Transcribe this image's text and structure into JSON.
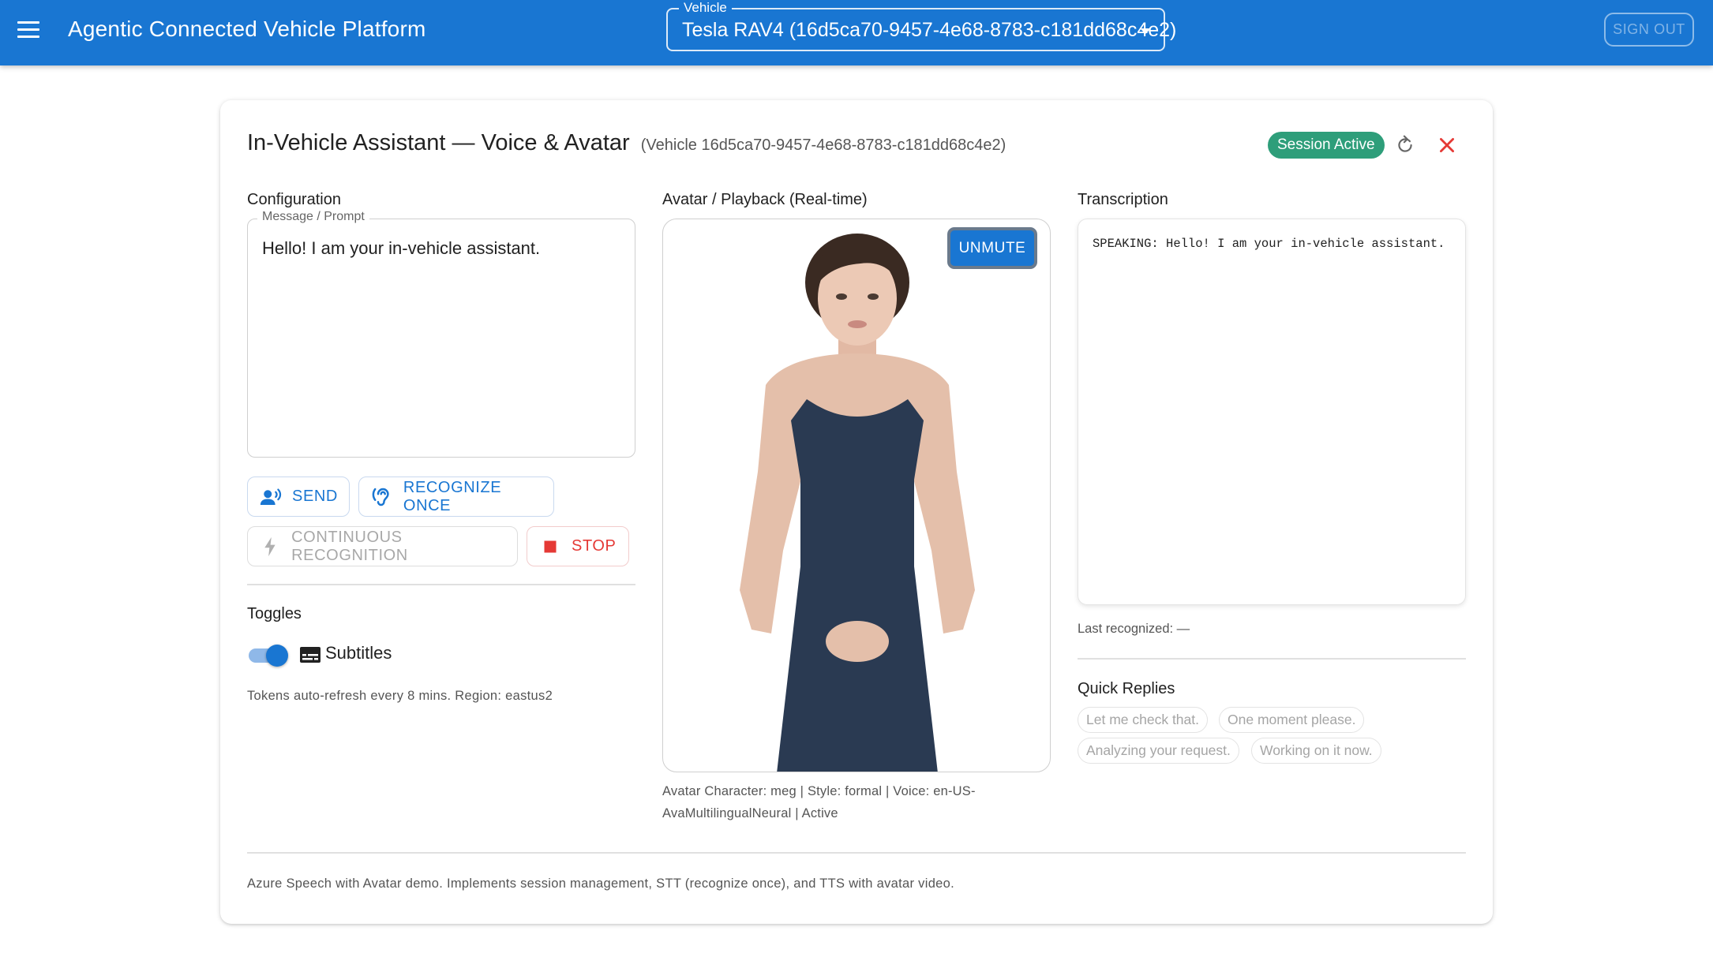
{
  "appbar": {
    "title": "Agentic Connected Vehicle Platform",
    "vehicle_label": "Vehicle",
    "vehicle_value": "Tesla RAV4 (16d5ca70-9457-4e68-8783-c181dd68c4e2)",
    "sign_out": "SIGN OUT"
  },
  "card": {
    "title": "In-Vehicle Assistant — Voice & Avatar",
    "subtitle": "(Vehicle 16d5ca70-9457-4e68-8783-c181dd68c4e2)",
    "status": "Session Active",
    "status_color": "#2e9e7a"
  },
  "config": {
    "heading": "Configuration",
    "message_label": "Message / Prompt",
    "message_value": "Hello! I am your in-vehicle assistant.",
    "send": "SEND",
    "recognize_once": "RECOGNIZE ONCE",
    "continuous": "CONTINUOUS RECOGNITION",
    "stop": "STOP"
  },
  "toggles": {
    "heading": "Toggles",
    "subtitles_label": "Subtitles",
    "subtitles_on": true,
    "note": "Tokens auto-refresh every 8 mins. Region: eastus2"
  },
  "avatar": {
    "heading": "Avatar / Playback (Real-time)",
    "unmute": "UNMUTE",
    "caption": "Avatar Character: meg | Style: formal | Voice: en-US-AvaMultilingualNeural | Active"
  },
  "transcription": {
    "heading": "Transcription",
    "text": "SPEAKING: Hello! I am your in-vehicle assistant.",
    "last_recognized": "Last recognized: —"
  },
  "quick_replies": {
    "heading": "Quick Replies",
    "items": [
      "Let me check that.",
      "One moment please.",
      "Analyzing your request.",
      "Working on it now."
    ]
  },
  "footer": "Azure Speech with Avatar demo. Implements session management, STT (recognize once), and TTS with avatar video.",
  "colors": {
    "primary": "#1976d2",
    "stop": "#e53935"
  }
}
